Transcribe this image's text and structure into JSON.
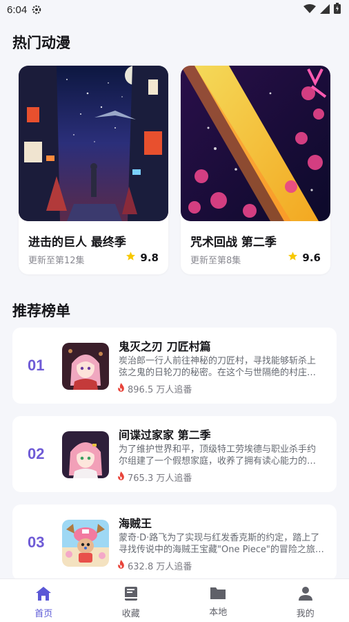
{
  "status_bar": {
    "time": "6:04"
  },
  "hot": {
    "title": "热门动漫",
    "items": [
      {
        "title": "进击的巨人 最终季",
        "update": "更新至第12集",
        "rating": "9.8"
      },
      {
        "title": "咒术回战 第二季",
        "update": "更新至第8集",
        "rating": "9.6"
      }
    ]
  },
  "ranking": {
    "title": "推荐榜单",
    "items": [
      {
        "rank": "01",
        "title": "鬼灭之刃 刀匠村篇",
        "desc": "炭治郎一行人前往神秘的刀匠村，寻找能够斩杀上弦之鬼的日轮刀的秘密。在这个与世隔绝的村庄…",
        "follows": "896.5 万人追番"
      },
      {
        "rank": "02",
        "title": "间谍过家家 第二季",
        "desc": "为了维护世界和平，顶级特工劳埃德与职业杀手约尔组建了一个假想家庭，收养了拥有读心能力的…",
        "follows": "765.3 万人追番"
      },
      {
        "rank": "03",
        "title": "海贼王",
        "desc": "蒙奇·D·路飞为了实现与红发香克斯的约定，踏上了寻找传说中的海贼王宝藏\"One Piece\"的冒险之旅…",
        "follows": "632.8 万人追番"
      }
    ]
  },
  "tabbar": {
    "home": "首页",
    "favorites": "收藏",
    "local": "本地",
    "mine": "我的"
  },
  "colors": {
    "accent": "#5a57d6",
    "rank": "#6f5bd6",
    "star": "#f7c800",
    "fire": "#e8443a"
  },
  "icons": [
    "settings-gear-icon",
    "wifi-icon",
    "cellular-signal-icon",
    "battery-icon",
    "star-icon",
    "fire-icon",
    "home-icon",
    "book-icon",
    "folder-icon",
    "person-icon"
  ]
}
